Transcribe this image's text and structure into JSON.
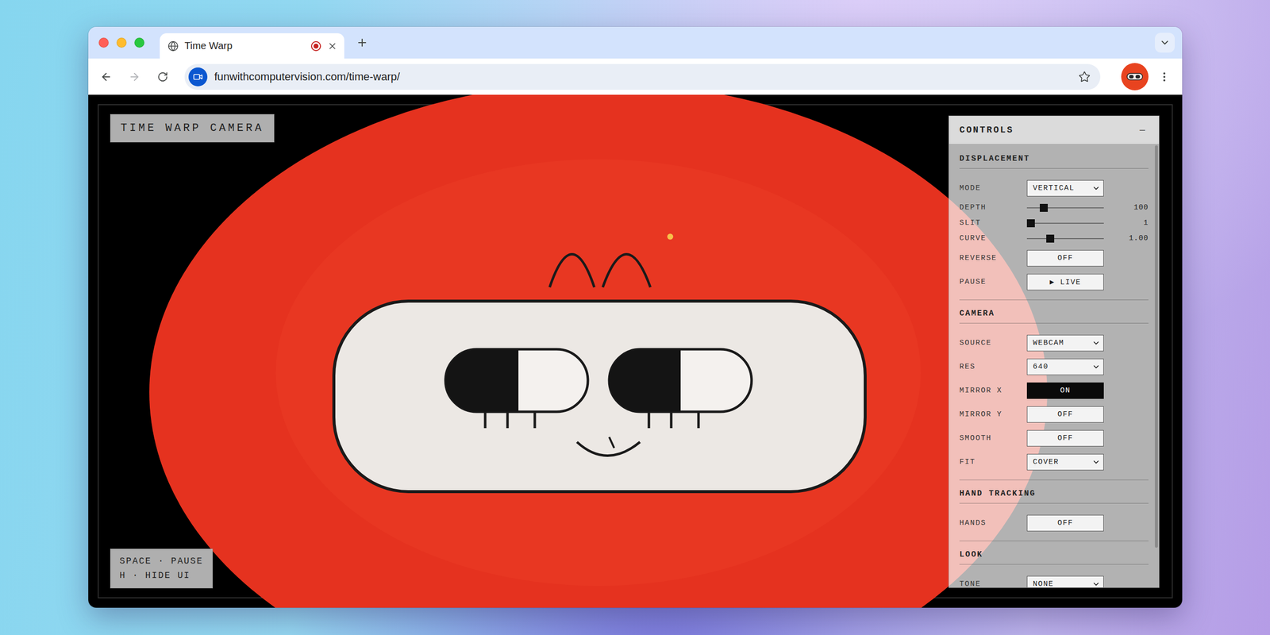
{
  "tabs": [
    {
      "label": "Time Warp",
      "selected": true,
      "recording": true
    }
  ],
  "toolbar": {
    "back": {
      "disabled": false
    },
    "forward": {
      "disabled": true
    },
    "url": "funwithcomputervision.com/time-warp/"
  },
  "overlay_title": "TIME WARP CAMERA",
  "hints": [
    "SPACE · PAUSE",
    "H · HIDE UI"
  ],
  "controls": {
    "title": "CONTROLS",
    "collapse": "—",
    "scrollbar": {
      "level": 0.91
    },
    "sections": [
      {
        "title": "DISPLACEMENT",
        "rows": [
          {
            "kind": "select",
            "label": "MODE",
            "value": "VERTICAL"
          },
          {
            "kind": "slider",
            "label": "DEPTH",
            "level": 0.19,
            "reading": "100"
          },
          {
            "kind": "slider",
            "label": "SLIT",
            "level": 0.0,
            "reading": "1"
          },
          {
            "kind": "slider",
            "label": "CURVE",
            "level": 0.28,
            "reading": "1.00"
          },
          {
            "kind": "toggle",
            "label": "REVERSE",
            "value": "OFF",
            "on": false
          },
          {
            "kind": "toggle",
            "label": "PAUSE",
            "value": "▶ LIVE",
            "on": false
          }
        ]
      },
      {
        "title": "CAMERA",
        "rows": [
          {
            "kind": "select",
            "label": "SOURCE",
            "value": "WEBCAM"
          },
          {
            "kind": "select",
            "label": "RES",
            "value": "640"
          },
          {
            "kind": "toggle",
            "label": "MIRROR X",
            "value": "ON",
            "on": true
          },
          {
            "kind": "toggle",
            "label": "MIRROR Y",
            "value": "OFF",
            "on": false
          },
          {
            "kind": "toggle",
            "label": "SMOOTH",
            "value": "OFF",
            "on": false
          },
          {
            "kind": "select",
            "label": "FIT",
            "value": "COVER"
          }
        ]
      },
      {
        "title": "HAND TRACKING",
        "rows": [
          {
            "kind": "toggle",
            "label": "HANDS",
            "value": "OFF",
            "on": false
          }
        ]
      },
      {
        "title": "LOOK",
        "rows": [
          {
            "kind": "select",
            "label": "TONE",
            "value": "NONE"
          }
        ]
      }
    ]
  }
}
